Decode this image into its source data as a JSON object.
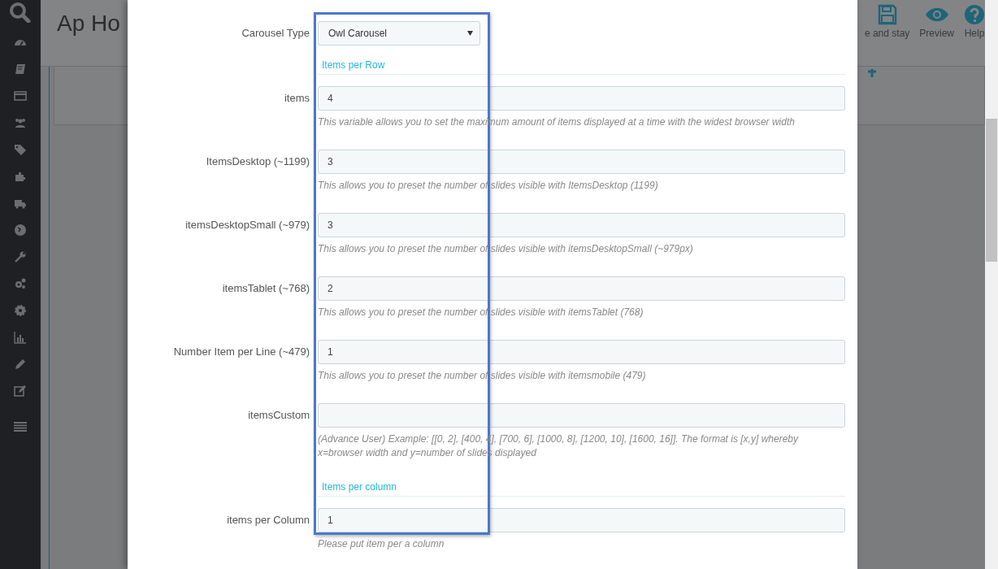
{
  "page_header": {
    "title": "Ap Ho",
    "toolbar": [
      {
        "kind": "save",
        "label": "e and stay"
      },
      {
        "kind": "preview",
        "label": "Preview"
      },
      {
        "kind": "help",
        "label": "Help"
      }
    ]
  },
  "modal": {
    "form": [
      {
        "kind": "select",
        "label": "Carousel Type",
        "value": "Owl Carousel"
      },
      {
        "kind": "section",
        "title": "Items per Row"
      },
      {
        "kind": "input",
        "label": "items",
        "value": "4",
        "help": "This variable allows you to set the maximum amount of items displayed at a time with the widest browser width"
      },
      {
        "kind": "input",
        "label": "ItemsDesktop (~1199)",
        "value": "3",
        "help": "This allows you to preset the number of slides visible with ItemsDesktop (1199)"
      },
      {
        "kind": "input",
        "label": "itemsDesktopSmall (~979)",
        "value": "3",
        "help": "This allows you to preset the number of slides visible with itemsDesktopSmall (~979px)"
      },
      {
        "kind": "input",
        "label": "itemsTablet (~768)",
        "value": "2",
        "help": "This allows you to preset the number of slides visible with itemsTablet (768)"
      },
      {
        "kind": "input",
        "label": "Number Item per Line (~479)",
        "value": "1",
        "help": "This allows you to preset the number of slides visible with itemsmobile (479)"
      },
      {
        "kind": "input",
        "label": "itemsCustom",
        "help": "(Advance User) Example: [[0, 2], [400, 4], [700, 6], [1000, 8], [1200, 10], [1600, 16]]. The format is [x,y] whereby x=browser width and y=number of slides displayed"
      },
      {
        "kind": "section",
        "title": "Items per column"
      },
      {
        "kind": "input",
        "label": "items per Column",
        "value": "1",
        "help": "Please put item per a column"
      }
    ]
  }
}
